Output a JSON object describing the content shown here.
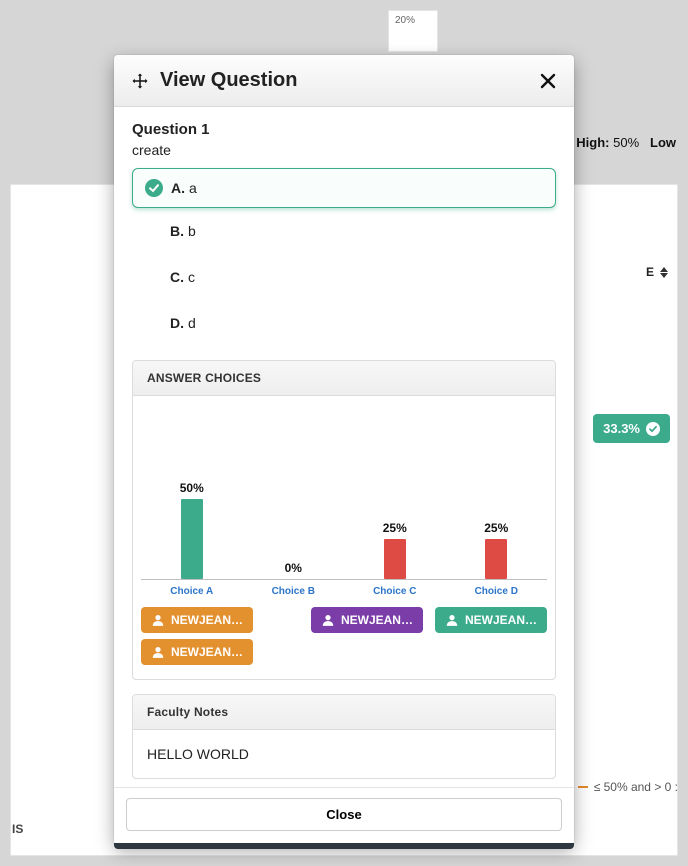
{
  "background": {
    "pct_box": "20%",
    "stats_high_label": "High:",
    "stats_high_value": "50%",
    "stats_low_label": "Low",
    "stats_prefix_pct": "%",
    "col_e": "E",
    "badge_value": "33.3%",
    "legend_text": "≤ 50% and > 0 :",
    "is_label": "IS"
  },
  "modal": {
    "title": "View Question",
    "question_heading": "Question 1",
    "question_text": "create",
    "choices": [
      {
        "letter": "A.",
        "text": "a",
        "correct": true
      },
      {
        "letter": "B.",
        "text": "b",
        "correct": false
      },
      {
        "letter": "C.",
        "text": "c",
        "correct": false
      },
      {
        "letter": "D.",
        "text": "d",
        "correct": false
      }
    ],
    "answer_section_title": "ANSWER CHOICES",
    "faculty_notes_title": "Faculty Notes",
    "faculty_notes_body": "HELLO WORLD",
    "close_label": "Close"
  },
  "chips": {
    "a": [
      "NEWJEAN…",
      "NEWJEAN…"
    ],
    "b": [],
    "c": [
      "NEWJEAN…"
    ],
    "d": [
      "NEWJEAN…"
    ]
  },
  "chip_colors": {
    "a": "orange",
    "b": "",
    "c": "purple",
    "d": "green"
  },
  "chart_data": {
    "type": "bar",
    "title": "",
    "xlabel": "",
    "ylabel": "",
    "ylim": [
      0,
      50
    ],
    "categories": [
      "Choice A",
      "Choice B",
      "Choice C",
      "Choice D"
    ],
    "values": [
      50,
      0,
      25,
      25
    ],
    "value_labels": [
      "50%",
      "0%",
      "25%",
      "25%"
    ],
    "bar_colors": [
      "green",
      "red",
      "red",
      "red"
    ]
  }
}
